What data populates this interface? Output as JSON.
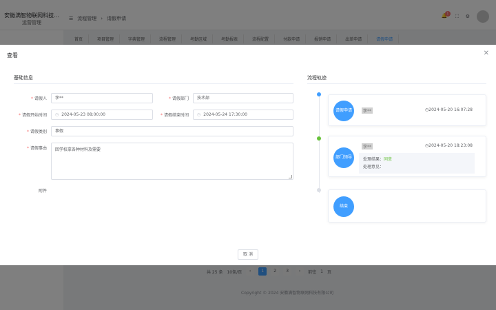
{
  "app": {
    "name": "安徽满智物联网科技...",
    "subtitle": "运营管理"
  },
  "breadcrumb": [
    "流程管理",
    "请假申请"
  ],
  "notif_count": "1",
  "bg_tabs": [
    "首页",
    "项目管理",
    "字典管理",
    "流程管理",
    "考勤区域",
    "考勤报表",
    "流程配置",
    "付款申请",
    "报销申请",
    "出差申请",
    "请假申请"
  ],
  "pager": {
    "total": "共 25 条",
    "size": "10条/页",
    "pages": [
      "1",
      "2",
      "3"
    ],
    "goto": "前往",
    "goto_page": "1",
    "page_suffix": "页"
  },
  "copyright": "Copyright © 2024 安徽满智物联网科技有限公司",
  "dialog": {
    "title": "查看",
    "basic_title": "基础信息",
    "flow_title": "流程轨迹",
    "fields": {
      "applicant_label": "请假人",
      "applicant_value": "李**",
      "dept_label": "请假部门",
      "dept_value": "技术部",
      "start_label": "请假开始时间",
      "start_value": "2024-05-23 08:00:00",
      "end_label": "请假结束时间",
      "end_value": "2024-05-24 17:30:00",
      "type_label": "请假类别",
      "type_value": "事假",
      "reason_label": "请假事由",
      "reason_value": "回学校拿各种材料及需要",
      "attach_label": "附件"
    },
    "timeline": [
      {
        "node": "请假申请",
        "person": "李**",
        "time": "2024-05-20 16:07:28"
      },
      {
        "node": "部门领导",
        "person": "李**",
        "time": "2024-05-20 18:23:08",
        "result_label": "处理结果：",
        "result_value": "同意",
        "opinion_label": "处理意见："
      },
      {
        "node": "结束"
      }
    ],
    "cancel": "取 消"
  },
  "colors": {
    "primary": "#409eff",
    "success": "#67c23a",
    "danger": "#f56c6c"
  }
}
